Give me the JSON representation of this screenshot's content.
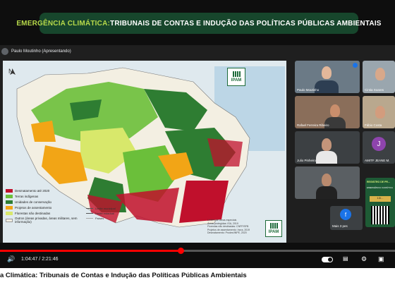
{
  "banner": {
    "accent": "EMERGÊNCIA CLIMÁTICA:",
    "rest": " TRIBUNAIS DE CONTAS E INDUÇÃO DAS POLÍTICAS PÚBLICAS AMBIENTAIS"
  },
  "presenter": {
    "label": "Paulo Moutinho (Apresentando)"
  },
  "slide": {
    "logo_name": "IPAM",
    "logo_sub": "AMAZÔNIA",
    "legend": [
      {
        "label": "Desmatamento até 2020",
        "color": "#c0102c"
      },
      {
        "label": "Terras indígenas",
        "color": "#6bbf3a"
      },
      {
        "label": "Unidades de conservação",
        "color": "#2e7d32"
      },
      {
        "label": "Projetos de assentamento",
        "color": "#f2a516"
      },
      {
        "label": "Florestas não destinadas",
        "color": "#d8e86b"
      },
      {
        "label": "Outros (áreas privadas, áreas militares, sem informação)",
        "color": "#f3efe2"
      }
    ],
    "legend2": [
      "Limite municipal",
      "Limite estadual",
      "Países"
    ],
    "credits": [
      "Limites de áreas especiais",
      "Áreas protegidas: ISA, 2019",
      "Florestas não destinadas: CNFP/SFB",
      "Projetos de assentamento: Incra, 2019",
      "Desmatamento: Prodes/INPE, 2020"
    ]
  },
  "participants": [
    {
      "name": "Paulo Moutinho"
    },
    {
      "name": "Cintia Soares"
    },
    {
      "name": "Rafael Ferreira Ribeiro"
    },
    {
      "name": "Fábio Costa"
    },
    {
      "name": "Julio Pinheiro"
    },
    {
      "name": "AMITF JEANE M."
    },
    {
      "name": ""
    },
    {
      "name": ""
    }
  ],
  "more_people": "Mais 3 pes",
  "card": {
    "title": "REGISTRO DE PR...",
    "sub": "EMERGÊNCIA CLIMÁTICA",
    "date": "13/..."
  },
  "avatar_letter": "J",
  "avatar_letter2": "f",
  "player": {
    "time": "1:04:47 / 2:21:46",
    "progress_fraction": 0.457,
    "icons": [
      "play-icon",
      "next-icon",
      "volume-icon",
      "autoplay-toggle",
      "subtitles-icon",
      "settings-icon",
      "miniplayer-icon"
    ]
  },
  "video_title": "a Climática: Tribunais de Contas e Indução das Políticas Públicas Ambientais"
}
